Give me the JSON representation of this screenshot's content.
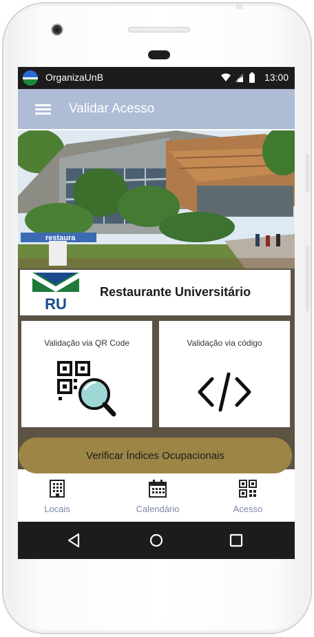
{
  "status_bar": {
    "app_name": "OrganizaUnB",
    "time": "13:00",
    "icons": [
      "wifi-icon",
      "signal-icon",
      "battery-icon"
    ]
  },
  "app_bar": {
    "menu_icon": "menu-icon",
    "title": "Validar Acesso"
  },
  "hero": {
    "image_description": "campus-building-photo",
    "sign_text": "restaura"
  },
  "restaurant": {
    "logo_text": "RU",
    "name": "Restaurante Universitário"
  },
  "validation_options": [
    {
      "label": "Validação via QR Code",
      "icon": "qr-code-search-icon"
    },
    {
      "label": "Validação via código",
      "icon": "code-brackets-icon"
    }
  ],
  "occupancy_button": {
    "label": "Verificar Índices Ocupacionais"
  },
  "bottom_nav": {
    "items": [
      {
        "label": "Locais",
        "icon": "building-icon"
      },
      {
        "label": "Calendário",
        "icon": "calendar-icon"
      },
      {
        "label": "Acesso",
        "icon": "qr-code-icon"
      }
    ]
  },
  "system_nav": [
    "back-icon",
    "home-icon",
    "recents-icon"
  ],
  "colors": {
    "app_bar": "#aebcd6",
    "accent_button": "#9c8545",
    "card_border": "#5c5344",
    "nav_label": "#7b86a8",
    "unb_blue": "#1b4a8c",
    "unb_green": "#1f7a3a"
  }
}
